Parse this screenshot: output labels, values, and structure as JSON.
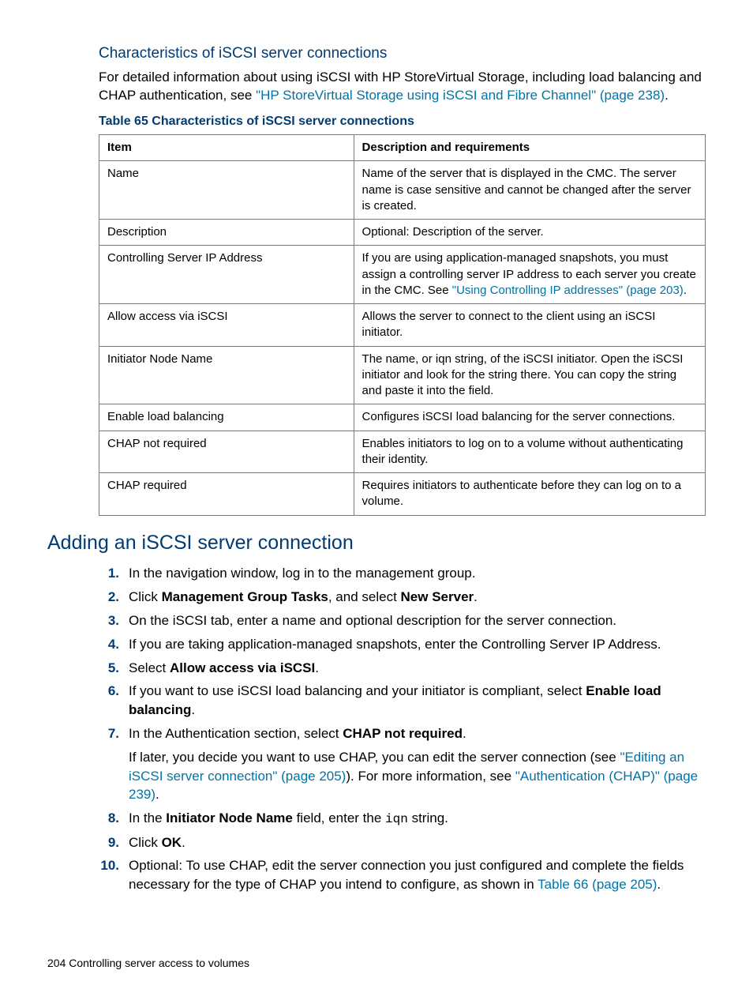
{
  "headings": {
    "h3_characteristics": "Characteristics of iSCSI server connections",
    "h2_adding": "Adding an iSCSI server connection"
  },
  "intro": {
    "pre": "For detailed information about using iSCSI with HP StoreVirtual Storage, including load balancing and CHAP authentication, see ",
    "link": "\"HP StoreVirtual Storage using iSCSI and Fibre Channel\" (page 238)",
    "post": "."
  },
  "table": {
    "caption": "Table 65 Characteristics of iSCSI server connections",
    "head": {
      "col1": "Item",
      "col2": "Description and requirements"
    },
    "rows": [
      {
        "c1": "Name",
        "c2": "Name of the server that is displayed in the CMC. The server name is case sensitive and cannot be changed after the server is created."
      },
      {
        "c1": "Description",
        "c2": "Optional: Description of the server."
      },
      {
        "c1": "Controlling Server IP Address",
        "c2_pre": "If you are using application-managed snapshots, you must assign a controlling server IP address to each server you create in the CMC. See ",
        "c2_link": "\"Using Controlling IP addresses\" (page 203)",
        "c2_post": "."
      },
      {
        "c1": "Allow access via iSCSI",
        "c2": "Allows the server to connect to the client using an iSCSI initiator."
      },
      {
        "c1": "Initiator Node Name",
        "c2": "The name, or iqn string, of the iSCSI initiator. Open the iSCSI initiator and look for the string there. You can copy the string and paste it into the field."
      },
      {
        "c1": "Enable load balancing",
        "c2": "Configures iSCSI load balancing for the server connections."
      },
      {
        "c1": "CHAP not required",
        "c2": "Enables initiators to log on to a volume without authenticating their identity."
      },
      {
        "c1": "CHAP required",
        "c2": "Requires initiators to authenticate before they can log on to a volume."
      }
    ]
  },
  "steps": {
    "s1": "In the navigation window, log in to the management group.",
    "s2": {
      "a": "Click ",
      "b": "Management Group Tasks",
      "c": ", and select ",
      "d": "New Server",
      "e": "."
    },
    "s3": "On the iSCSI tab, enter a name and optional description for the server connection.",
    "s4": "If you are taking application-managed snapshots, enter the Controlling Server IP Address.",
    "s5": {
      "a": "Select ",
      "b": "Allow access via iSCSI",
      "c": "."
    },
    "s6": {
      "a": "If you want to use iSCSI load balancing and your initiator is compliant, select ",
      "b": "Enable load balancing",
      "c": "."
    },
    "s7": {
      "a": "In the Authentication section, select ",
      "b": "CHAP not required",
      "c": "."
    },
    "s7sub": {
      "a": "If later, you decide you want to use CHAP, you can edit the server connection (see ",
      "link1": "\"Editing an iSCSI server connection\" (page 205)",
      "b": "). For more information, see ",
      "link2": "\"Authentication (CHAP)\" (page 239)",
      "c": "."
    },
    "s8": {
      "a": "In the ",
      "b": "Initiator Node Name",
      "c": " field, enter the ",
      "d": "iqn",
      "e": " string."
    },
    "s9": {
      "a": "Click ",
      "b": "OK",
      "c": "."
    },
    "s10": {
      "a": "Optional: To use CHAP, edit the server connection you just configured and complete the fields necessary for the type of CHAP you intend to configure, as shown in ",
      "link": "Table 66 (page 205)",
      "b": "."
    }
  },
  "nums": {
    "n1": "1.",
    "n2": "2.",
    "n3": "3.",
    "n4": "4.",
    "n5": "5.",
    "n6": "6.",
    "n7": "7.",
    "n8": "8.",
    "n9": "9.",
    "n10": "10."
  },
  "footer": {
    "page": "204",
    "sep": "   ",
    "title": "Controlling server access to volumes"
  }
}
